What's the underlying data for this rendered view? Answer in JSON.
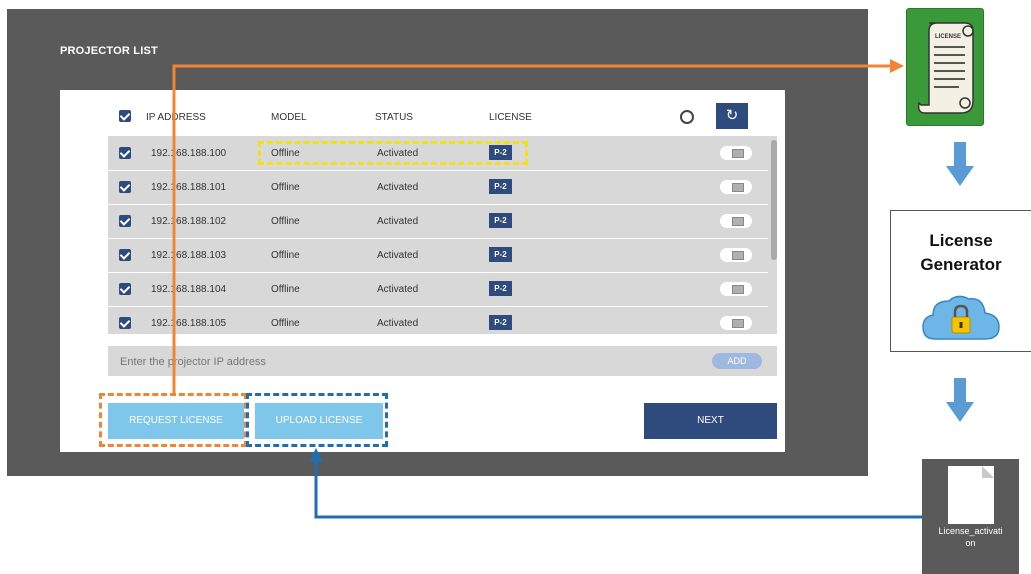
{
  "panel": {
    "title": "PROJECTOR LIST"
  },
  "columns": {
    "ip": "IP ADDRESS",
    "model": "MODEL",
    "status": "STATUS",
    "license": "LICENSE"
  },
  "rows": [
    {
      "ip": "192.168.188.100",
      "model": "Offline",
      "status": "Activated",
      "license": "P-2"
    },
    {
      "ip": "192.168.188.101",
      "model": "Offline",
      "status": "Activated",
      "license": "P-2"
    },
    {
      "ip": "192.168.188.102",
      "model": "Offline",
      "status": "Activated",
      "license": "P-2"
    },
    {
      "ip": "192.168.188.103",
      "model": "Offline",
      "status": "Activated",
      "license": "P-2"
    },
    {
      "ip": "192.168.188.104",
      "model": "Offline",
      "status": "Activated",
      "license": "P-2"
    },
    {
      "ip": "192.168.188.105",
      "model": "Offline",
      "status": "Activated",
      "license": "P-2"
    }
  ],
  "ip_entry": {
    "placeholder": "Enter the projector IP address",
    "add_label": "ADD"
  },
  "buttons": {
    "request": "REQUEST LICENSE",
    "upload": "UPLOAD LICENSE",
    "next": "NEXT"
  },
  "side": {
    "license_icon_text": "LICENSE",
    "generator_line1": "License",
    "generator_line2": "Generator",
    "file_line1": "License_activati",
    "file_line2": "on"
  },
  "colors": {
    "accent": "#2f4a7c",
    "light_button": "#7ec6ea",
    "orange": "#f08537",
    "blue": "#1f6fb0",
    "yellow": "#f5e017",
    "arrow_blue": "#5b9bd5"
  }
}
